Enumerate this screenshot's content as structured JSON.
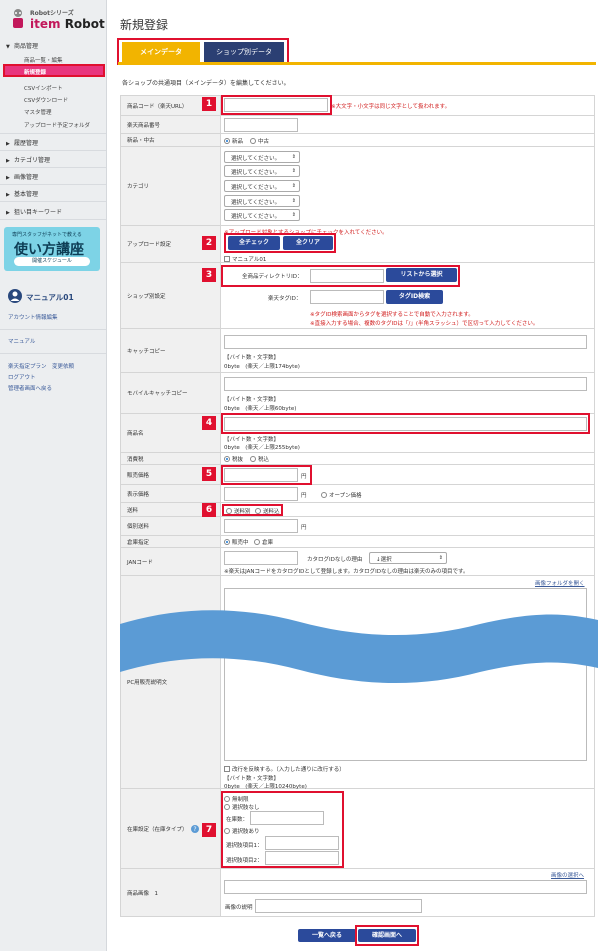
{
  "app": {
    "sub": "Robotシリーズ",
    "name_prefix": "item",
    "name": "Robot"
  },
  "sidebar": {
    "product_mgmt": "商品管理",
    "items": [
      "商品一覧・編集",
      "新規登録",
      "CSVインポート",
      "CSVダウンロード",
      "マスタ管理",
      "アップロード予定フォルダ"
    ],
    "sections": [
      "履歴管理",
      "カテゴリ管理",
      "画像管理",
      "基本管理",
      "狙い目キーワード"
    ],
    "banner_top": "専門スタッフがネットで教える",
    "banner_big": "使い方講座",
    "banner_btn": "開催スケジュール",
    "user": "マニュアル01",
    "account_edit": "アカウント情報編集",
    "manual": "マニュアル",
    "plan_change": "楽天指定プラン　変更依頼",
    "logout": "ログアウト",
    "admin_back": "管理者画面へ戻る"
  },
  "main": {
    "title": "新規登録",
    "tab_main": "メインデータ",
    "tab_shop": "ショップ別データ",
    "intro": "各ショップの共通項目（メインデータ）を編集してください。"
  },
  "form": {
    "product_code": "商品コード（楽天URL）",
    "product_code_note": "※大文字・小文字は同じ文字として扱われます。",
    "rakuten_no": "楽天商品番号",
    "new_used": "新品・中古",
    "opt_new": "新品",
    "opt_used": "中古",
    "category": "カテゴリ",
    "select_placeholder": "選択してください。",
    "upload": "アップロード設定",
    "upload_note": "※アップロード対象とするショップにチェックを入れてください。",
    "check_all": "全チェック",
    "clear_all": "全クリア",
    "shop_manual": "マニュアル01",
    "shop_setting": "ショップ別設定",
    "dir_id": "全商品ディレクトリID：",
    "from_list": "リストから選択",
    "tag_id": "楽天タグID：",
    "tag_search": "タグID検索",
    "tag_note1": "※タグID検索画面からタグを選択することで自動で入力されます。",
    "tag_note2": "※直接入力する場合、複数のタグIDは「/」(半角スラッシュ）で区切って入力してください。",
    "catch": "キャッチコピー",
    "bytes": "【バイト数・文字数】",
    "catch_limit": "0byte　(楽天／上限174byte)",
    "mobile_catch": "モバイルキャッチコピー",
    "mobile_limit": "0byte　(楽天／上限60byte)",
    "name": "商品名",
    "name_limit": "0byte　(楽天／上限255byte)",
    "tax": "消費税",
    "tax_excl": "税抜",
    "tax_incl": "税込",
    "price": "販売価格",
    "yen": "円",
    "display_price": "表示価格",
    "open_price": "オープン価格",
    "shipping": "送料",
    "ship_excl": "送料別",
    "ship_incl": "送料込",
    "indiv_shipping": "個別送料",
    "warehouse": "倉庫指定",
    "on_sale": "販売中",
    "in_warehouse": "倉庫",
    "jan": "JANコード",
    "no_catalog": "カタログIDなしの理由",
    "jan_select": "↓選択",
    "jan_note": "※楽天はJANコードをカタログIDとして登録します。カタログIDなしの理由は楽天のみの項目です。",
    "open_folder": "画像フォルダを開く",
    "pc_desc": "PC用販売説明文",
    "newline_label": "改行を反映する。（入力した通りに改行する）",
    "pc_limit": "0byte　(楽天／上限10240byte)",
    "stock": "在庫設定（在庫タイプ）",
    "no_stock": "無制限",
    "no_option": "選択肢なし",
    "stock_count": "在庫数：",
    "with_option": "選択肢あり",
    "option1": "選択肢項目1：",
    "option2": "選択肢項目2：",
    "img_select": "画像の選択へ",
    "product_image": "商品画像　1",
    "img_desc": "画像の説明",
    "back": "一覧へ戻る",
    "confirm": "確認画面へ"
  },
  "markers": [
    "1",
    "2",
    "3",
    "4",
    "5",
    "6",
    "7"
  ],
  "colors": {
    "accent": "#f2b400",
    "navy": "#2b3f73",
    "marker": "#e0102f",
    "active": "#e8367e",
    "wave": "#5b9bd5"
  }
}
